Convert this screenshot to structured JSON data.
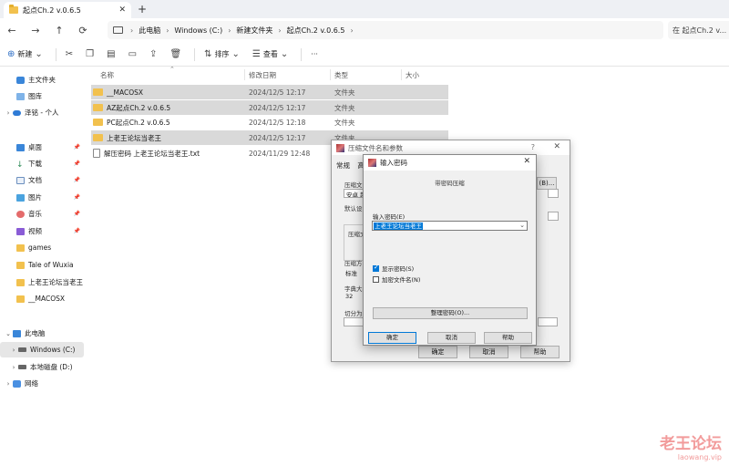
{
  "tab": {
    "title": "起点Ch.2 v.0.6.5",
    "close": "✕",
    "new": "+"
  },
  "nav": {
    "back": "←",
    "forward": "→",
    "up": "↑",
    "refresh": "⟳"
  },
  "breadcrumb": [
    "此电脑",
    "Windows (C:)",
    "新建文件夹",
    "起点Ch.2 v.0.6.5"
  ],
  "breadcrumb_sep": "›",
  "search": {
    "placeholder": "在 起点Ch.2 v..."
  },
  "toolbar": {
    "new_label": "新建",
    "sort_label": "排序",
    "view_label": "查看",
    "more_label": "···"
  },
  "sidebar": {
    "home": "主文件夹",
    "gallery": "图库",
    "cloud": "泽铭 - 个人",
    "desktop": "桌面",
    "downloads": "下载",
    "documents": "文档",
    "pictures": "图片",
    "music": "音乐",
    "videos": "视频",
    "games": "games",
    "wuxia": "Tale of Wuxia",
    "forum": "上老王论坛当老王",
    "macosx": "__MACOSX",
    "thispc": "此电脑",
    "cdrive": "Windows (C:)",
    "ddrive": "本地磁盘 (D:)",
    "network": "网络"
  },
  "columns": {
    "name": "名称",
    "date": "修改日期",
    "type": "类型",
    "size": "大小"
  },
  "files": [
    {
      "name": "__MACOSX",
      "date": "2024/12/5 12:17",
      "type": "文件夹"
    },
    {
      "name": "AZ起点Ch.2 v.0.6.5",
      "date": "2024/12/5 12:17",
      "type": "文件夹"
    },
    {
      "name": "PC起点Ch.2 v.0.6.5",
      "date": "2024/12/5 12:18",
      "type": "文件夹"
    },
    {
      "name": "上老王论坛当老王",
      "date": "2024/12/5 12:17",
      "type": "文件夹"
    },
    {
      "name": "解压密码 上老王论坛当老王.txt",
      "date": "2024/11/29 12:48",
      "type": "文本文档"
    }
  ],
  "back_dialog": {
    "title": "压缩文件名和参数",
    "help": "?",
    "close": "✕",
    "tab_general": "常规",
    "tab_next": "高",
    "archive_label": "压缩文",
    "archive_value": "安卓 起",
    "browse_btn": "(B)...",
    "default_label": "默认设",
    "format_label": "压缩文",
    "method_label": "压缩方",
    "method_value": "标准",
    "dict_label": "字典大小",
    "dict_value": "32",
    "split_label": "切分为",
    "ok": "确定",
    "cancel": "取消",
    "help_btn": "帮助"
  },
  "front_dialog": {
    "title": "输入密码",
    "close": "✕",
    "heading": "带密码压缩",
    "pw_label": "输入密码(E)",
    "pw_value": "上老王论坛当老王",
    "show_pw": "显示密码(S)",
    "encrypt_names": "加密文件名(N)",
    "organize_btn": "整理密码(O)...",
    "ok": "确定",
    "cancel": "取消",
    "help": "帮助"
  },
  "watermark": {
    "name": "老王论坛",
    "url": "laowang.vip"
  }
}
